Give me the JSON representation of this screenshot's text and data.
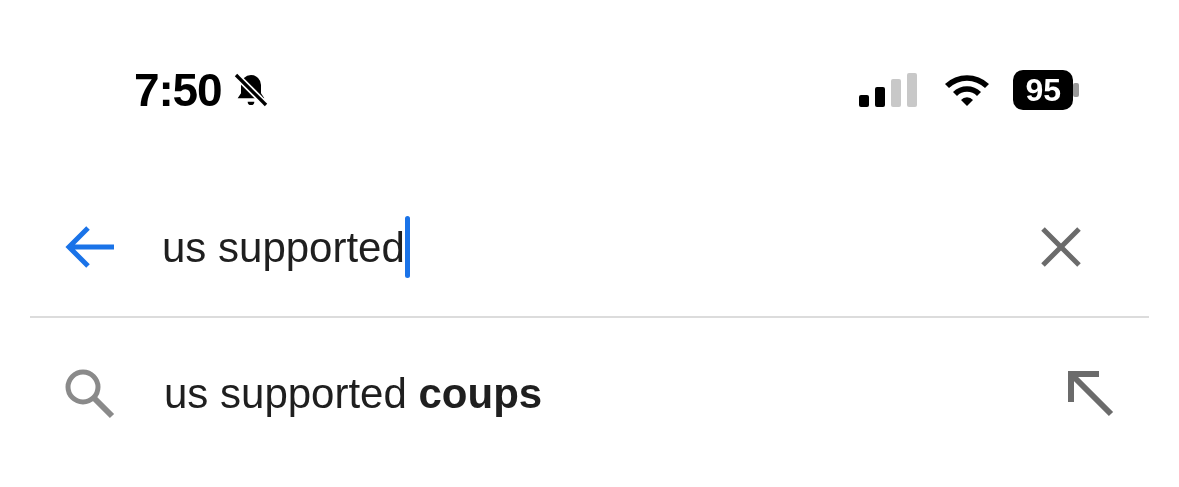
{
  "status_bar": {
    "time": "7:50",
    "battery": "95"
  },
  "search": {
    "value": "us supported"
  },
  "suggestions": [
    {
      "text": "us supported **coups**"
    }
  ]
}
